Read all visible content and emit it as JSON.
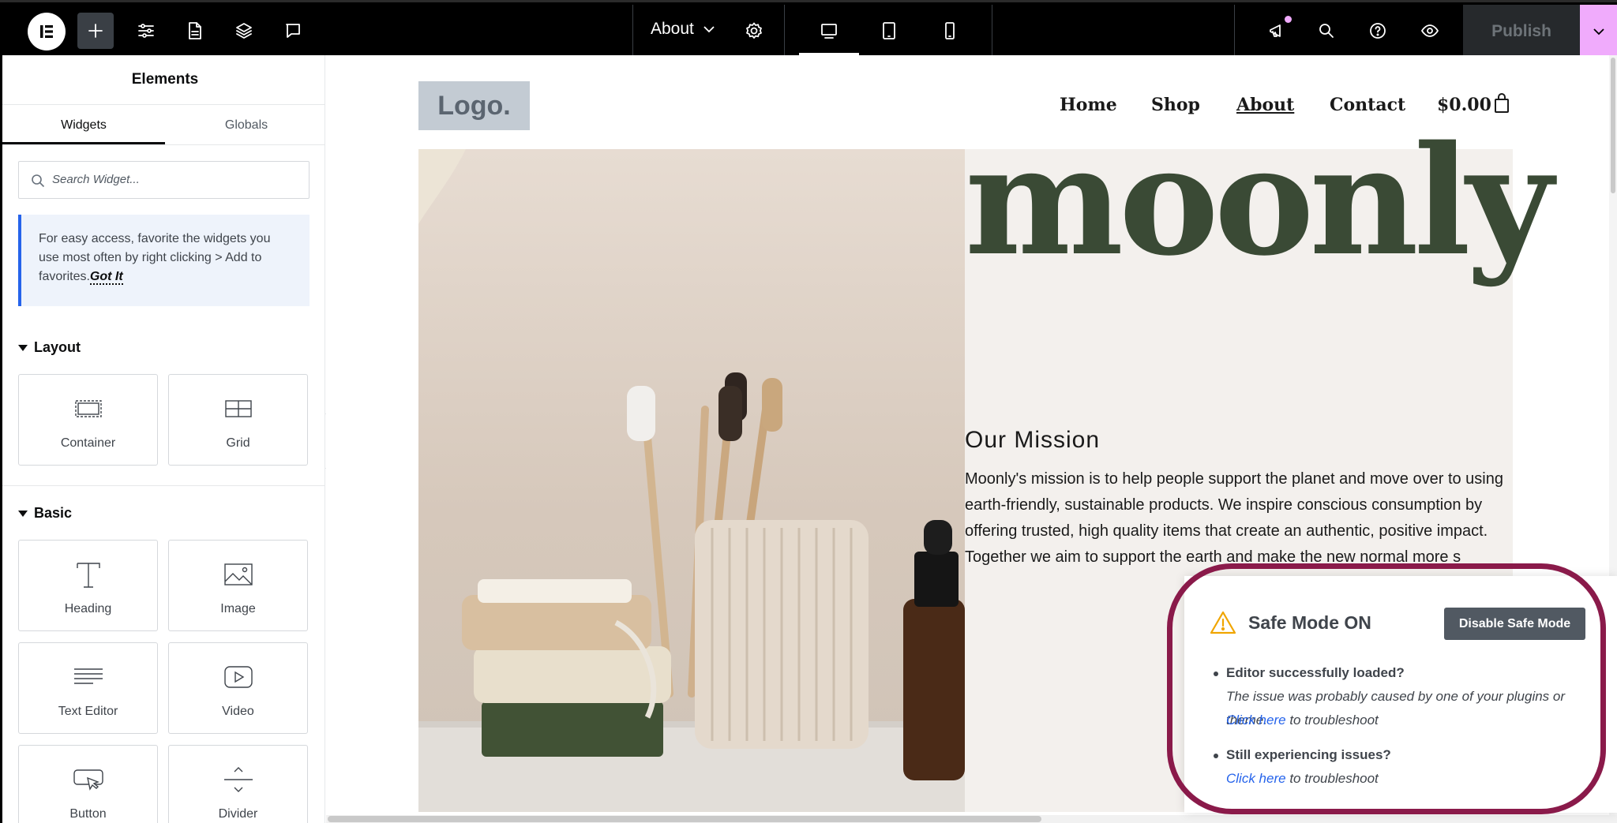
{
  "topbar": {
    "page_name": "About",
    "publish_label": "Publish",
    "icons": [
      "elementor-logo-icon",
      "add-element-icon",
      "site-settings-icon",
      "structure-icon",
      "layers-icon",
      "comments-icon",
      "chevron-down-icon",
      "page-settings-icon",
      "desktop-icon",
      "tablet-icon",
      "mobile-icon",
      "whats-new-icon",
      "search-icon",
      "help-icon",
      "preview-icon",
      "chevron-down-icon"
    ],
    "accent": "#f0abfc"
  },
  "panel": {
    "title": "Elements",
    "tabs": [
      {
        "label": "Widgets"
      },
      {
        "label": "Globals"
      }
    ],
    "search_placeholder": "Search Widget...",
    "tip_text": "For easy access, favorite the widgets you use most often by right clicking > Add to favorites.",
    "tip_link": "Got It",
    "sections": [
      {
        "title": "Layout",
        "widgets": [
          {
            "label": "Container"
          },
          {
            "label": "Grid"
          }
        ]
      },
      {
        "title": "Basic",
        "widgets": [
          {
            "label": "Heading"
          },
          {
            "label": "Image"
          },
          {
            "label": "Text Editor"
          },
          {
            "label": "Video"
          },
          {
            "label": "Button"
          },
          {
            "label": "Divider"
          }
        ]
      }
    ]
  },
  "site": {
    "logo": "Logo.",
    "nav": [
      {
        "label": "Home"
      },
      {
        "label": "Shop"
      },
      {
        "label": "About"
      },
      {
        "label": "Contact"
      }
    ],
    "cart": "$0.00",
    "brand": "moonly",
    "mission_heading": "Our Mission",
    "mission_text": "Moonly's mission is to help people support the planet and move over to using earth-friendly, sustainable products. We inspire conscious consumption by offering trusted, high quality items that create an authentic, positive impact. Together we aim to support the earth and make the new normal more s",
    "brand_color": "#3a4a35"
  },
  "safe_mode": {
    "title": "Safe Mode ON",
    "button": "Disable Safe Mode",
    "q1": "Editor successfully loaded?",
    "a1": "The issue was probably caused by one of your plugins or theme.",
    "link1": "Click here",
    "suffix1": " to troubleshoot",
    "q2": "Still experiencing issues?",
    "link2": "Click here",
    "suffix2": " to troubleshoot",
    "highlight_color": "#8a1a4a"
  }
}
